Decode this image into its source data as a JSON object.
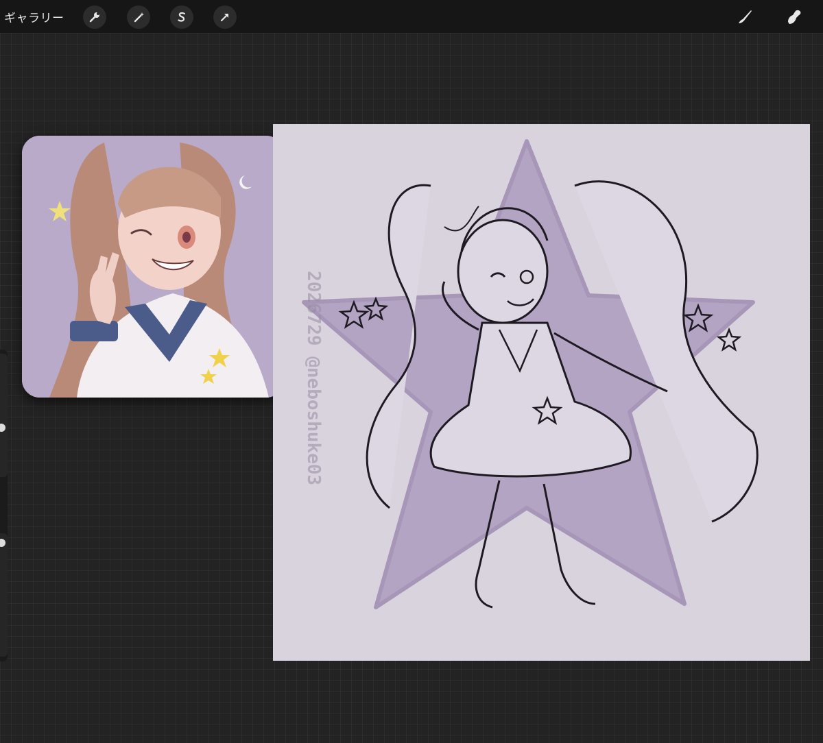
{
  "topbar": {
    "gallery_label": "ギャラリー",
    "left_tools": [
      {
        "icon": "wrench-icon"
      },
      {
        "icon": "magic-wand-icon"
      },
      {
        "icon": "selection-s-icon"
      },
      {
        "icon": "transform-arrow-icon"
      }
    ],
    "right_tools": [
      {
        "icon": "brush-icon"
      },
      {
        "icon": "smudge-icon"
      }
    ]
  },
  "canvas": {
    "watermark_line1": "2026729",
    "watermark_line2": "@neboshuke03"
  },
  "colors": {
    "background": "#232323",
    "topbar": "#161616",
    "canvas": "#d9d3de",
    "star": "#b4a4c4",
    "reference_bg": "#b9aac9",
    "sketch_line": "#1e1a22"
  }
}
